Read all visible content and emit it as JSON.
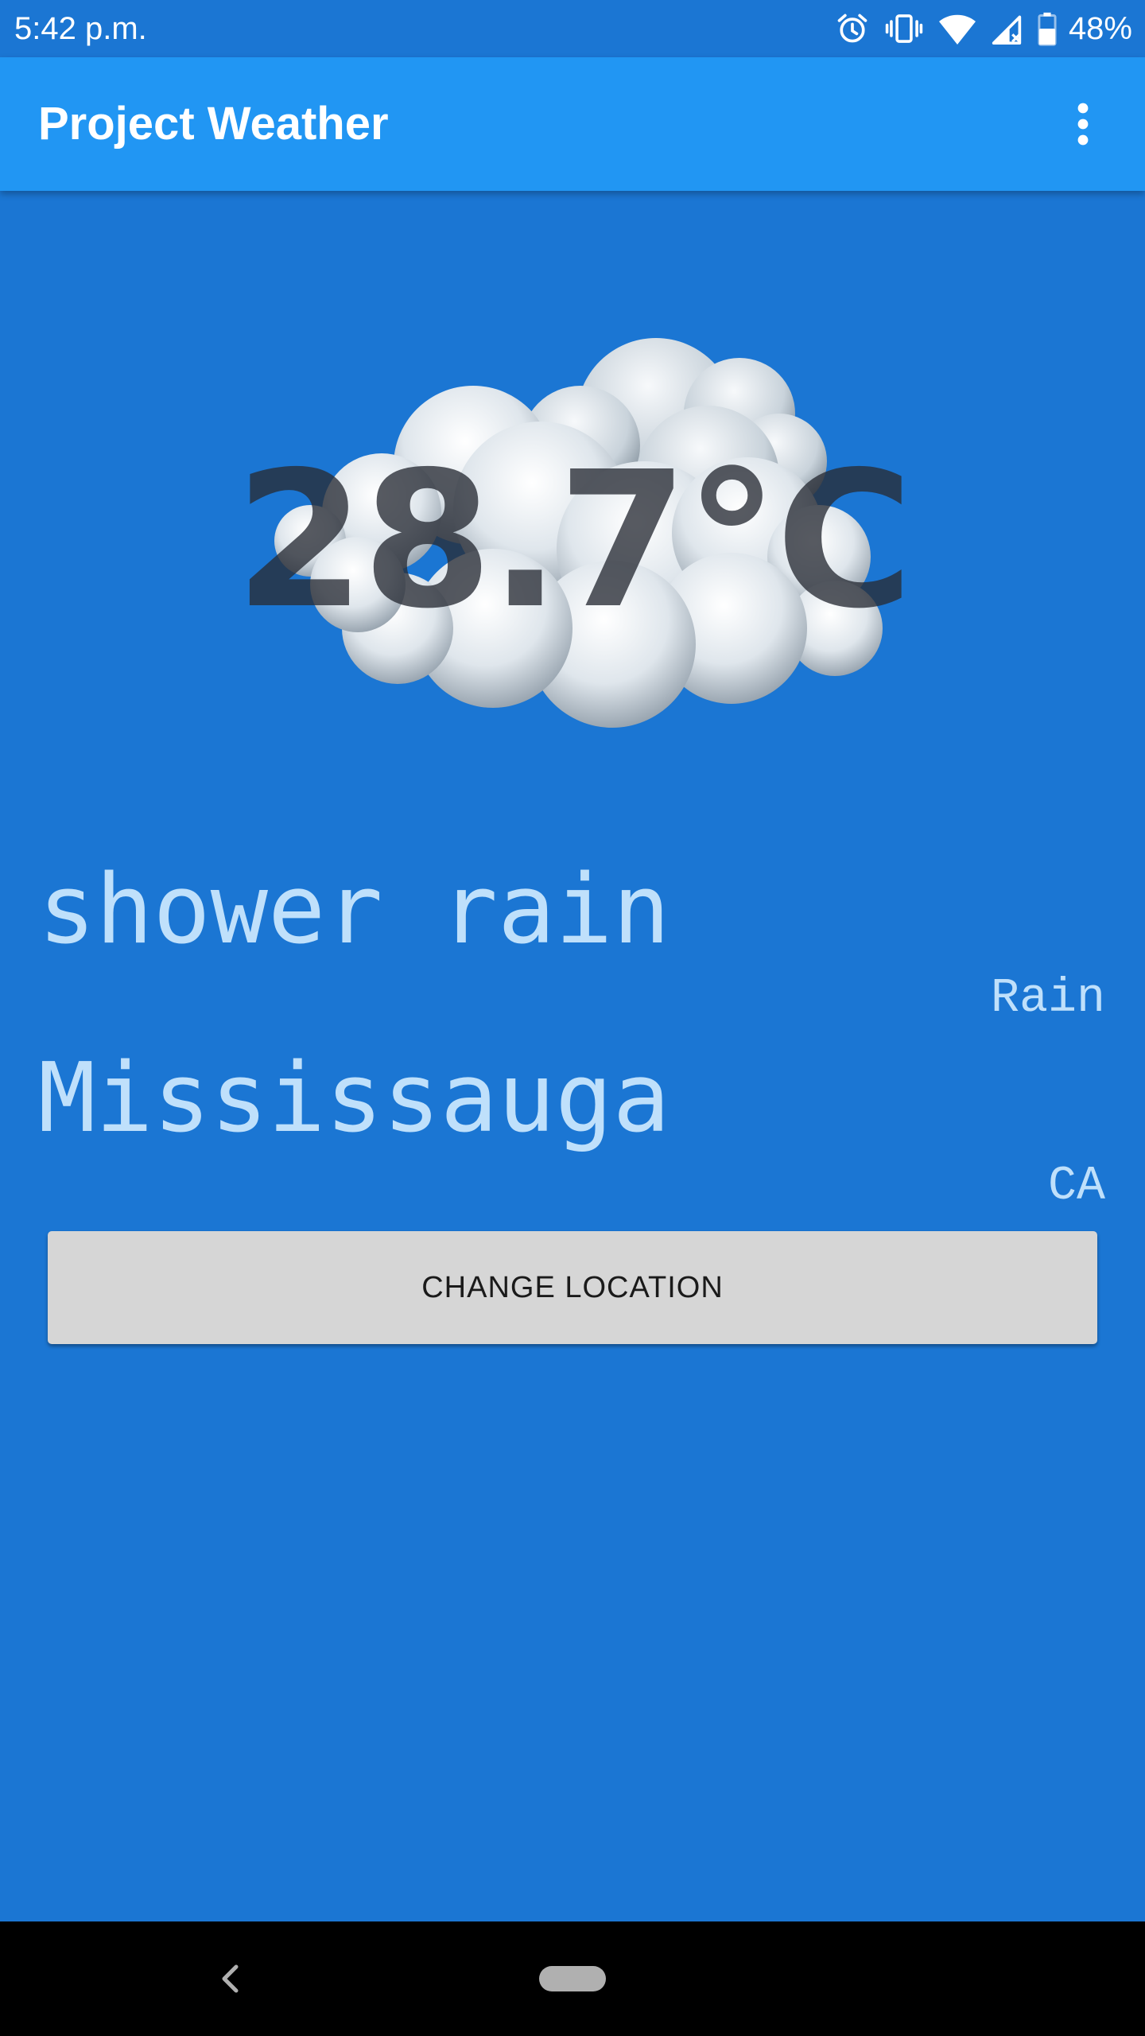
{
  "status_bar": {
    "time": "5:42 p.m.",
    "battery_percent": "48%",
    "icons": [
      "alarm-icon",
      "vibrate-icon",
      "wifi-icon",
      "cell-signal-icon",
      "battery-icon"
    ]
  },
  "app_bar": {
    "title": "Project Weather",
    "menu_icon": "overflow-menu-icon"
  },
  "weather": {
    "icon": "cloud-icon",
    "temperature": "28.7°C",
    "description": "shower rain",
    "main": "Rain",
    "city": "Mississauga",
    "country": "CA"
  },
  "actions": {
    "change_location_label": "CHANGE LOCATION"
  },
  "nav_bar": {
    "back_icon": "back-icon",
    "home_icon": "home-pill-icon"
  },
  "colors": {
    "background": "#1b76d3",
    "app_bar": "#2196f3",
    "text_light": "#bfe0fb",
    "button": "#d6d6d6"
  }
}
